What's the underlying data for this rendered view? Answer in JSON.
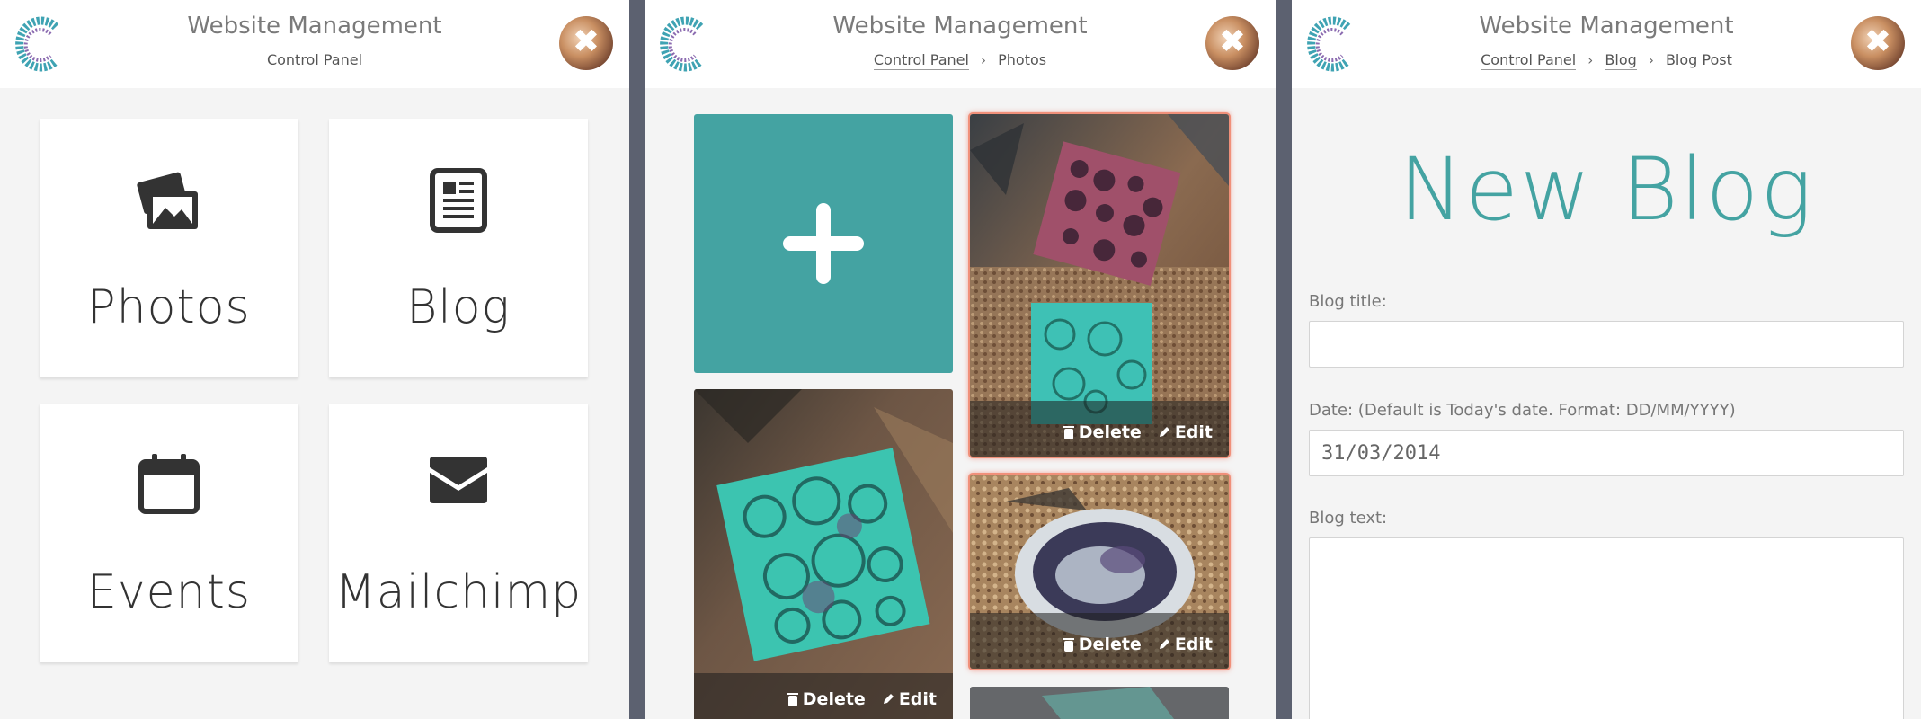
{
  "app": {
    "title": "Website Management",
    "close_symbol": "✖"
  },
  "dashboard": {
    "breadcrumb": "Control Panel",
    "tiles": [
      {
        "label": "Photos",
        "icon": "photos-icon"
      },
      {
        "label": "Blog",
        "icon": "newspaper-icon"
      },
      {
        "label": "Events",
        "icon": "calendar-icon"
      },
      {
        "label": "Mailchimp",
        "icon": "envelope-icon"
      }
    ]
  },
  "photos": {
    "breadcrumb": {
      "root": "Control Panel",
      "current": "Photos",
      "separator": "›"
    },
    "add_symbol": "+",
    "delete_label": "Delete",
    "edit_label": "Edit"
  },
  "blog_post": {
    "breadcrumb": {
      "root": "Control Panel",
      "parent": "Blog",
      "current": "Blog Post",
      "separator": "›"
    },
    "heading": "New Blog",
    "title_label": "Blog title:",
    "title_value": "",
    "date_label": "Date: (Default is Today's date. Format: DD/MM/YYYY)",
    "date_value": "31/03/2014",
    "text_label": "Blog text:"
  },
  "colors": {
    "accent": "#44a3a2",
    "selection": "#f0907a",
    "divider": "#5c6170"
  }
}
